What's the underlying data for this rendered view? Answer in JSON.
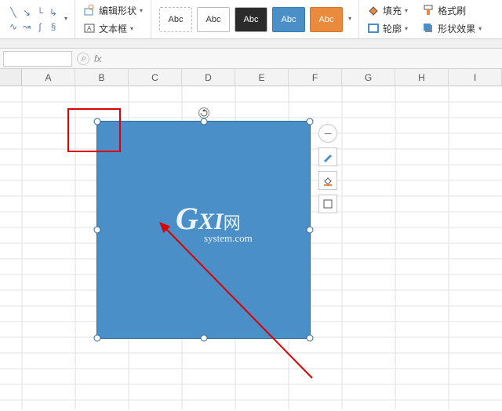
{
  "ribbon": {
    "edit_shape_label": "编辑形状",
    "text_box_label": "文本框",
    "style_swatch_text": "Abc",
    "fill_label": "填充",
    "format_painter_label": "格式刷",
    "outline_label": "轮廓",
    "shape_effect_label": "形状效果"
  },
  "formula_bar": {
    "fx_label": "fx"
  },
  "columns": [
    "A",
    "B",
    "C",
    "D",
    "E",
    "F",
    "G",
    "H",
    "I"
  ],
  "watermark": {
    "g": "G",
    "xi": "XI",
    "cn": "网",
    "sub": "system.com"
  },
  "floating_tools": {
    "plus": "＋",
    "minus": "－"
  }
}
